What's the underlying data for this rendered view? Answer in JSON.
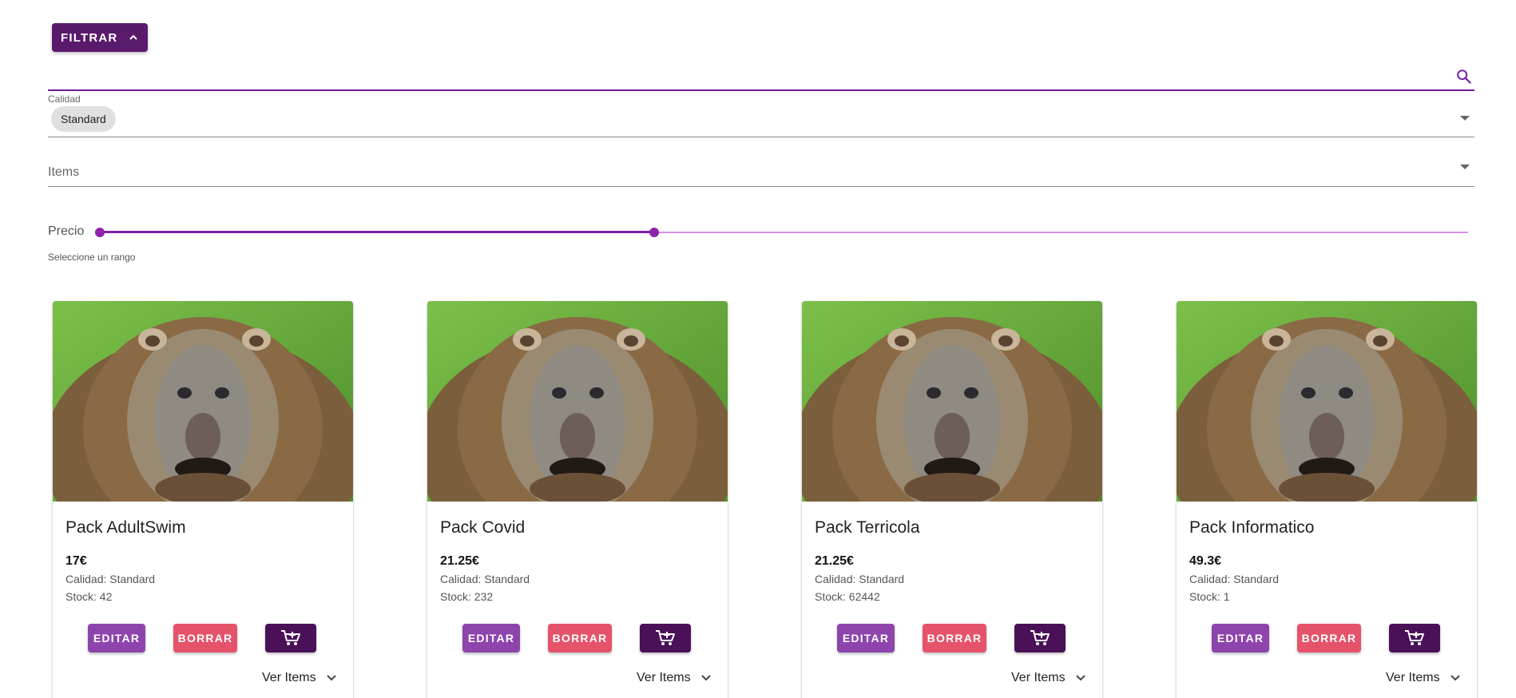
{
  "toolbar": {
    "filter_label": "FILTRAR"
  },
  "search": {
    "value": "",
    "placeholder": ""
  },
  "filters": {
    "quality": {
      "label": "Calidad",
      "chip": "Standard"
    },
    "items": {
      "label": "Items"
    },
    "price": {
      "label": "Precio",
      "help": "Seleccione un rango",
      "range_start_fraction": 0.0,
      "range_end_fraction": 0.405
    }
  },
  "colors": {
    "primary": "#5a1a6b",
    "accent": "#8e24aa",
    "edit": "#8e44ad",
    "delete": "#e5536a",
    "cart": "#4a1159"
  },
  "cards": [
    {
      "title": "Pack AdultSwim",
      "price": "17€",
      "quality": "Calidad: Standard",
      "stock": "Stock: 42",
      "edit": "EDITAR",
      "delete": "BORRAR",
      "cart_icon": "cart-add-icon",
      "ver_items": "Ver Items"
    },
    {
      "title": "Pack Covid",
      "price": "21.25€",
      "quality": "Calidad: Standard",
      "stock": "Stock: 232",
      "edit": "EDITAR",
      "delete": "BORRAR",
      "cart_icon": "cart-add-icon",
      "ver_items": "Ver Items"
    },
    {
      "title": "Pack Terricola",
      "price": "21.25€",
      "quality": "Calidad: Standard",
      "stock": "Stock: 62442",
      "edit": "EDITAR",
      "delete": "BORRAR",
      "cart_icon": "cart-add-icon",
      "ver_items": "Ver Items"
    },
    {
      "title": "Pack Informatico",
      "price": "49.3€",
      "quality": "Calidad: Standard",
      "stock": "Stock: 1",
      "edit": "EDITAR",
      "delete": "BORRAR",
      "cart_icon": "cart-add-icon",
      "ver_items": "Ver Items"
    }
  ]
}
